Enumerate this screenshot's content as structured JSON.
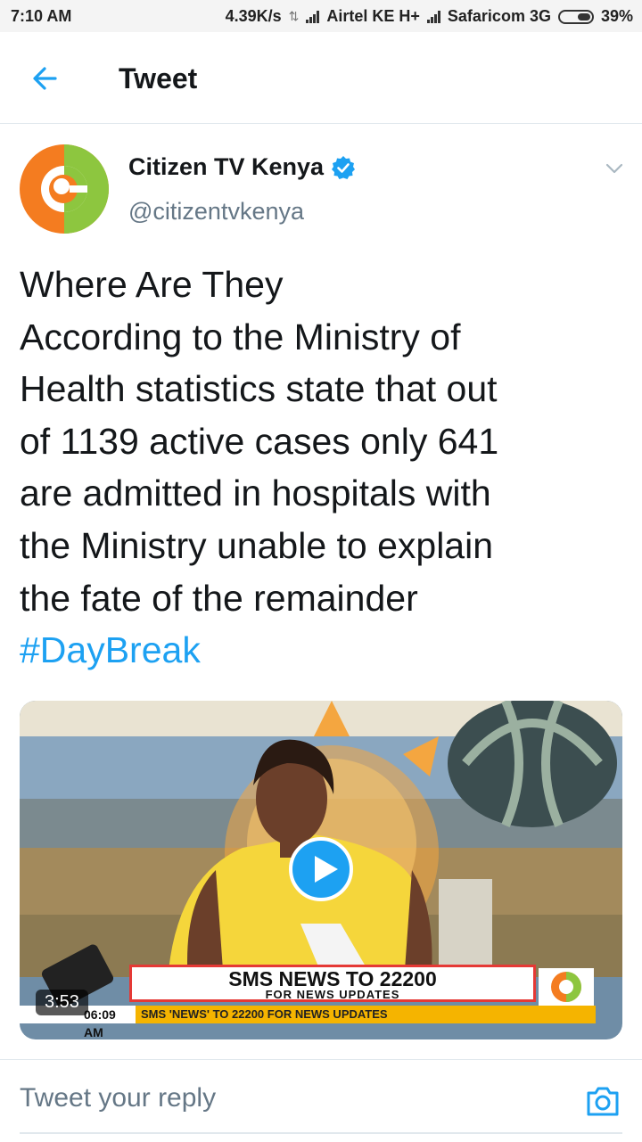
{
  "status_bar": {
    "time": "7:10 AM",
    "speed": "4.39K/s",
    "carrier1": "Airtel KE H+",
    "carrier2": "Safaricom 3G",
    "battery": "39%"
  },
  "header": {
    "title": "Tweet",
    "back_icon": "arrow-left-icon"
  },
  "tweet": {
    "author_name": "Citizen TV Kenya",
    "author_handle": "@citizentvkenya",
    "verified": true,
    "body_lines": [
      "Where Are They",
      "According to the Ministry of",
      "Health statistics state that out",
      "of 1139 active cases only 641",
      "are admitted in hospitals with",
      "the Ministry unable to explain",
      "the fate of the remainder"
    ],
    "hashtag": "#DayBreak"
  },
  "media": {
    "duration": "3:53",
    "banner_title": "SMS NEWS TO 22200",
    "banner_subtitle": "FOR NEWS UPDATES",
    "ticker_time": "06:09 AM",
    "ticker_text": "SMS 'NEWS' TO 22200 FOR NEWS UPDATES"
  },
  "reply": {
    "placeholder": "Tweet your reply",
    "camera_icon": "camera-icon"
  },
  "colors": {
    "accent": "#1da1f2",
    "text": "#14171a",
    "muted": "#657786",
    "brand_orange": "#f47c20",
    "brand_green": "#8dc63f"
  }
}
